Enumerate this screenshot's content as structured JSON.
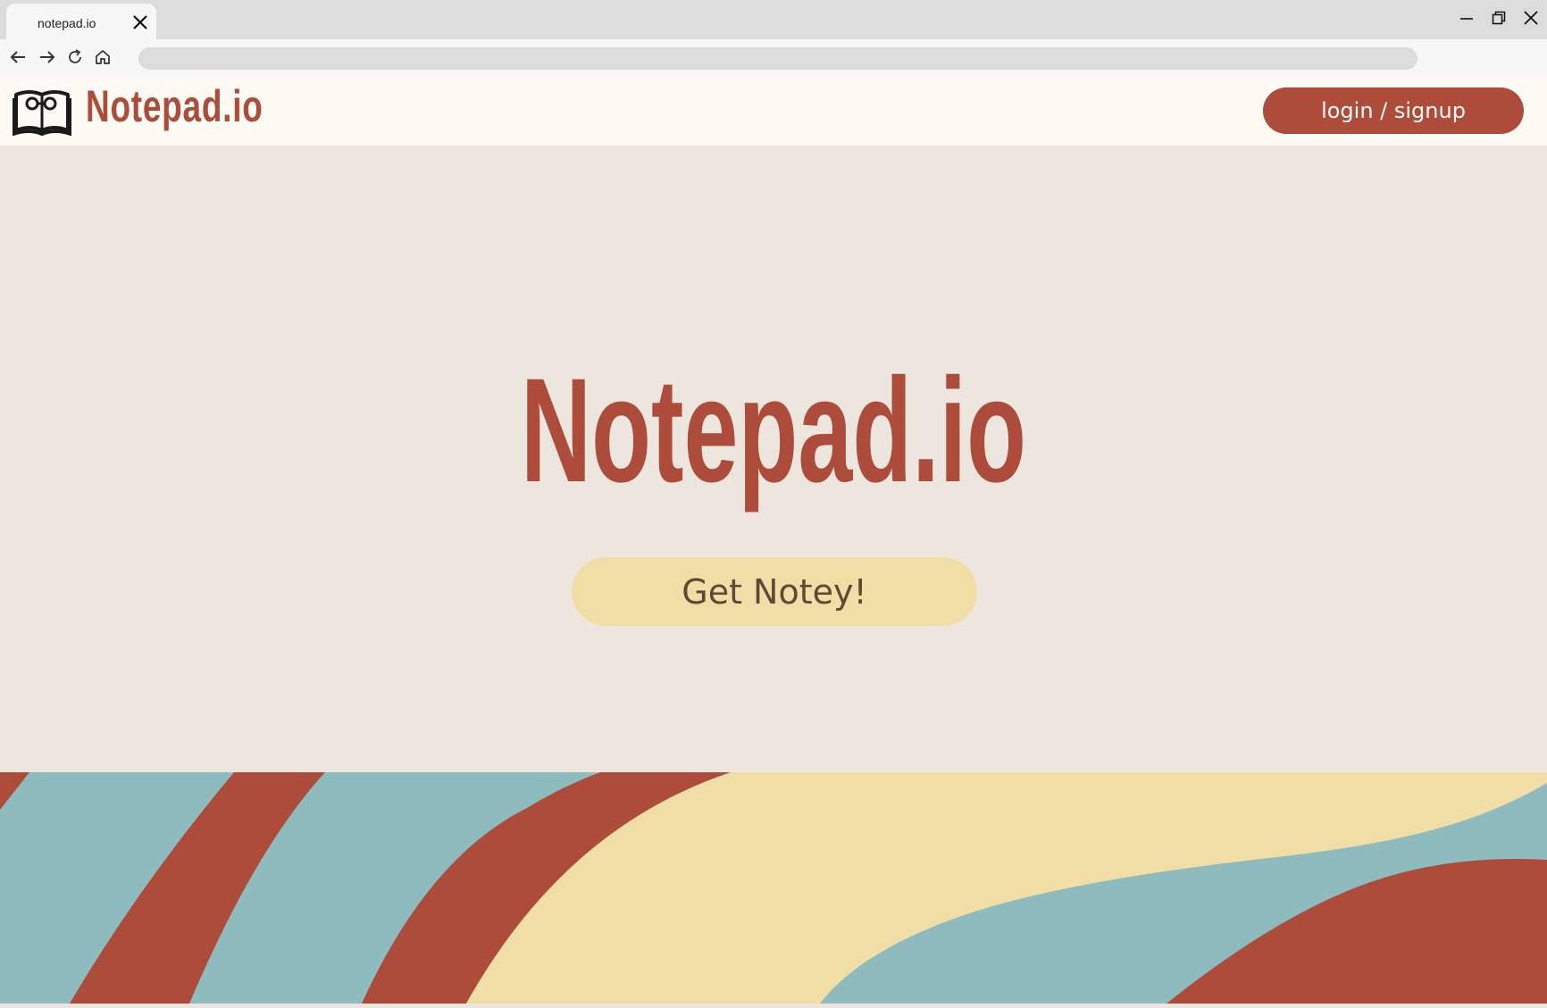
{
  "browser": {
    "tab_title": "notepad.io",
    "icons": {
      "tab_close": "close-icon",
      "minimize": "minimize-icon",
      "restore": "restore-icon",
      "close": "close-icon",
      "back": "arrow-left-icon",
      "forward": "arrow-right-icon",
      "reload": "reload-icon",
      "home": "home-icon"
    }
  },
  "header": {
    "logo_text": "Notepad.io",
    "logo_icon": "book-glasses-icon",
    "login_label": "login / signup"
  },
  "hero": {
    "title": "Notepad.io",
    "cta_label": "Get Notey!"
  },
  "colors": {
    "brand_red": "#ad4c3a",
    "cream": "#f1dea7",
    "teal": "#8dbbbe",
    "background": "#ede6df",
    "header_bg": "#fdf9f3"
  }
}
